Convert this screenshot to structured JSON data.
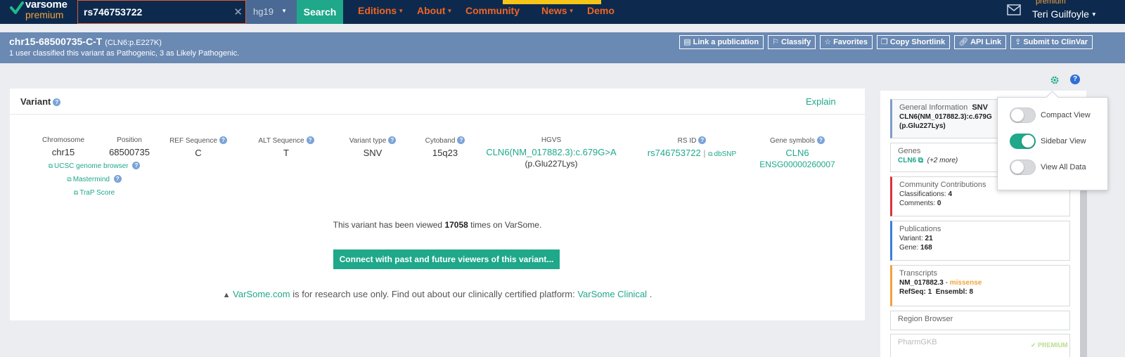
{
  "brand": {
    "name": "varsome",
    "tier": "premium",
    "accent": "#1fa88a",
    "nav_bg": "#0d2a4e",
    "orange": "#f06523"
  },
  "search": {
    "value": "rs746753722",
    "assembly": "hg19",
    "button": "Search"
  },
  "nav": {
    "items": [
      "Editions",
      "About",
      "Community",
      "News",
      "Demo"
    ]
  },
  "user": {
    "tier": "premium",
    "name": "Teri Guilfoyle"
  },
  "variant_bar": {
    "title": "chr15-68500735-C-T",
    "protein": "(CLN6:p.E227K)",
    "subtitle": "1 user classified this variant as Pathogenic, 3 as Likely Pathogenic.",
    "actions": [
      "Link a publication",
      "Classify",
      "Favorites",
      "Copy Shortlink",
      "API Link",
      "Submit to ClinVar"
    ]
  },
  "card": {
    "title": "Variant",
    "explain": "Explain",
    "fields": {
      "chromosome": {
        "label": "Chromosome",
        "value": "chr15"
      },
      "position": {
        "label": "Position",
        "value": "68500735"
      },
      "ref": {
        "label": "REF Sequence",
        "value": "C"
      },
      "alt": {
        "label": "ALT Sequence",
        "value": "T"
      },
      "vtype": {
        "label": "Variant type",
        "value": "SNV"
      },
      "cytoband": {
        "label": "Cytoband",
        "value": "15q23"
      },
      "hgvs": {
        "label": "HGVS",
        "value": "CLN6(NM_017882.3):c.679G>A",
        "sub": "(p.Glu227Lys)"
      },
      "rsid": {
        "label": "RS ID",
        "value": "rs746753722",
        "sep": "|",
        "link": "dbSNP"
      },
      "genes": {
        "label": "Gene symbols",
        "value": "CLN6",
        "sub": "ENSG00000260007"
      }
    },
    "links": [
      "UCSC genome browser",
      "Mastermind",
      "TraP Score"
    ],
    "viewed_pre": "This variant has been viewed",
    "viewed_count": "17058",
    "viewed_post": "times on VarSome.",
    "connect": "Connect with past and future viewers of this variant...",
    "disclaimer_link": "VarSome.com",
    "disclaimer_mid": "is for research use only. Find out about our clinically certified platform:",
    "disclaimer_link2": "VarSome Clinical",
    "disclaimer_end": "."
  },
  "sidebar": {
    "general": {
      "title": "General Information",
      "type": "SNV",
      "line1": "CLN6(NM_017882.3):c.679G",
      "line2": "(p.Glu227Lys)"
    },
    "genes": {
      "title": "Genes",
      "gene": "CLN6",
      "more": "(+2 more)"
    },
    "community": {
      "title": "Community Contributions",
      "cls_label": "Classifications:",
      "cls": "4",
      "com_label": "Comments:",
      "com": "0"
    },
    "publications": {
      "title": "Publications",
      "var_label": "Variant:",
      "var": "21",
      "gene_label": "Gene:",
      "gene": "168"
    },
    "transcripts": {
      "title": "Transcripts",
      "tx": "NM_017882.3",
      "dash": "-",
      "effect": "missense",
      "refseq_label": "RefSeq:",
      "refseq": "1",
      "ensembl_label": "Ensembl:",
      "ensembl": "8"
    },
    "region": {
      "title": "Region Browser"
    },
    "pharm": {
      "title": "PharmGKB"
    },
    "badge": "PREMIUM"
  },
  "view_menu": {
    "options": [
      {
        "label": "Compact View",
        "on": false
      },
      {
        "label": "Sidebar View",
        "on": true
      },
      {
        "label": "View All Data",
        "on": false
      }
    ]
  }
}
